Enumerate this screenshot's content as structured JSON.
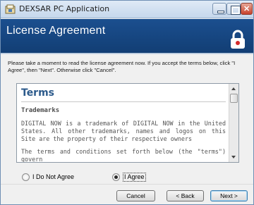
{
  "window": {
    "title": "DEXSAR PC Application",
    "icon": "installer-app-icon"
  },
  "banner": {
    "title": "License Agreement",
    "icon": "lock-icon",
    "background": "#1b4f8f"
  },
  "intro": {
    "text": "Please take a moment to read the license agreement now. If you accept the terms below, click \"I Agree\", then \"Next\". Otherwise click \"Cancel\"."
  },
  "license": {
    "heading": "Terms",
    "subheading": "Trademarks",
    "paragraph1": "DIGITAL NOW is a trademark of DIGITAL NOW in the United States. All other trademarks, names and logos on this Site are the property of their respective owners",
    "paragraph2": "The terms and conditions set forth below (the \"terms\") govern"
  },
  "options": {
    "not_agree": "I Do Not Agree",
    "agree": "I Agree",
    "selected": "agree"
  },
  "buttons": {
    "cancel": "Cancel",
    "back": "< Back",
    "next": "Next >"
  },
  "colors": {
    "accent": "#2c5a8b",
    "banner": "#1b4f8f"
  }
}
